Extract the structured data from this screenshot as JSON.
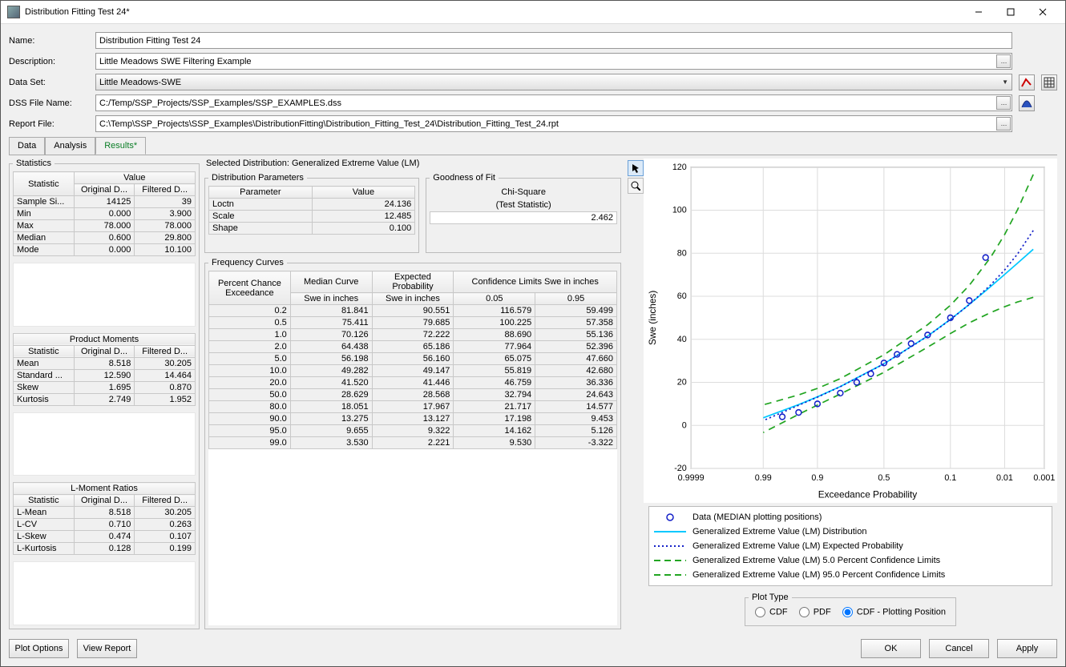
{
  "title": "Distribution Fitting Test 24*",
  "form": {
    "name_label": "Name:",
    "name_value": "Distribution Fitting Test 24",
    "desc_label": "Description:",
    "desc_value": "Little Meadows SWE Filtering Example",
    "dataset_label": "Data Set:",
    "dataset_value": "Little Meadows-SWE",
    "dssfile_label": "DSS File Name:",
    "dssfile_value": "C:/Temp/SSP_Projects/SSP_Examples/SSP_EXAMPLES.dss",
    "report_label": "Report File:",
    "report_value": "C:\\Temp\\SSP_Projects\\SSP_Examples\\DistributionFitting\\Distribution_Fitting_Test_24\\Distribution_Fitting_Test_24.rpt"
  },
  "tabs": {
    "data": "Data",
    "analysis": "Analysis",
    "results": "Results*"
  },
  "stats": {
    "fs_title": "Statistics",
    "hdr_stat": "Statistic",
    "hdr_value": "Value",
    "hdr_orig": "Original D...",
    "hdr_filt": "Filtered D...",
    "section1": [
      [
        "Sample Si...",
        "14125",
        "39"
      ],
      [
        "Min",
        "0.000",
        "3.900"
      ],
      [
        "Max",
        "78.000",
        "78.000"
      ],
      [
        "Median",
        "0.600",
        "29.800"
      ],
      [
        "Mode",
        "0.000",
        "10.100"
      ]
    ],
    "pm_title": "Product Moments",
    "pm": [
      [
        "Mean",
        "8.518",
        "30.205"
      ],
      [
        "Standard ...",
        "12.590",
        "14.464"
      ],
      [
        "Skew",
        "1.695",
        "0.870"
      ],
      [
        "Kurtosis",
        "2.749",
        "1.952"
      ]
    ],
    "lm_title": "L-Moment Ratios",
    "lm": [
      [
        "L-Mean",
        "8.518",
        "30.205"
      ],
      [
        "L-CV",
        "0.710",
        "0.263"
      ],
      [
        "L-Skew",
        "0.474",
        "0.107"
      ],
      [
        "L-Kurtosis",
        "0.128",
        "0.199"
      ]
    ]
  },
  "selected_dist_label": "Selected Distribution: Generalized Extreme Value (LM)",
  "params": {
    "title": "Distribution Parameters",
    "hdr_param": "Parameter",
    "hdr_value": "Value",
    "rows": [
      [
        "Loctn",
        "24.136"
      ],
      [
        "Scale",
        "12.485"
      ],
      [
        "Shape",
        "0.100"
      ]
    ]
  },
  "gof": {
    "title": "Goodness of Fit",
    "name": "Chi-Square",
    "sub": "(Test Statistic)",
    "value": "2.462"
  },
  "freq": {
    "title": "Frequency Curves",
    "hdr_pce": "Percent Chance Exceedance",
    "hdr_med": "Median Curve",
    "hdr_exp": "Expected Probability",
    "hdr_cl": "Confidence Limits Swe in inches",
    "hdr_swe": "Swe in inches",
    "hdr_005": "0.05",
    "hdr_095": "0.95",
    "rows": [
      [
        "0.2",
        "81.841",
        "90.551",
        "116.579",
        "59.499"
      ],
      [
        "0.5",
        "75.411",
        "79.685",
        "100.225",
        "57.358"
      ],
      [
        "1.0",
        "70.126",
        "72.222",
        "88.690",
        "55.136"
      ],
      [
        "2.0",
        "64.438",
        "65.186",
        "77.964",
        "52.396"
      ],
      [
        "5.0",
        "56.198",
        "56.160",
        "65.075",
        "47.660"
      ],
      [
        "10.0",
        "49.282",
        "49.147",
        "55.819",
        "42.680"
      ],
      [
        "20.0",
        "41.520",
        "41.446",
        "46.759",
        "36.336"
      ],
      [
        "50.0",
        "28.629",
        "28.568",
        "32.794",
        "24.643"
      ],
      [
        "80.0",
        "18.051",
        "17.967",
        "21.717",
        "14.577"
      ],
      [
        "90.0",
        "13.275",
        "13.127",
        "17.198",
        "9.453"
      ],
      [
        "95.0",
        "9.655",
        "9.322",
        "14.162",
        "5.126"
      ],
      [
        "99.0",
        "3.530",
        "2.221",
        "9.530",
        "-3.322"
      ]
    ]
  },
  "chart": {
    "ylabel": "Swe (inches)",
    "xlabel": "Exceedance Probability",
    "yticks": [
      "-20",
      "0",
      "20",
      "40",
      "60",
      "80",
      "100",
      "120"
    ],
    "xticks": [
      "0.9999",
      "0.99",
      "0.9",
      "0.5",
      "0.1",
      "0.01",
      "0.001"
    ]
  },
  "legend": {
    "l1": "Data (MEDIAN plotting positions)",
    "l2": "Generalized Extreme Value (LM) Distribution",
    "l3": "Generalized Extreme Value (LM) Expected Probability",
    "l4": "Generalized Extreme Value (LM) 5.0 Percent Confidence Limits",
    "l5": "Generalized Extreme Value (LM) 95.0 Percent Confidence Limits"
  },
  "plot_type": {
    "title": "Plot Type",
    "cdf": "CDF",
    "pdf": "PDF",
    "cdfpp": "CDF - Plotting Position"
  },
  "buttons": {
    "plot_options": "Plot Options",
    "view_report": "View Report",
    "ok": "OK",
    "cancel": "Cancel",
    "apply": "Apply"
  },
  "chart_data": {
    "type": "line",
    "xlabel": "Exceedance Probability",
    "ylabel": "Swe (inches)",
    "ylim": [
      -20,
      120
    ],
    "x_tick_labels": [
      "0.9999",
      "0.99",
      "0.9",
      "0.5",
      "0.1",
      "0.01",
      "0.001"
    ],
    "x_axis": "probability",
    "series": [
      {
        "name": "Distribution (Median Curve)",
        "x": [
          0.2,
          0.5,
          1.0,
          2.0,
          5.0,
          10.0,
          20.0,
          50.0,
          80.0,
          90.0,
          95.0,
          99.0
        ],
        "y": [
          81.841,
          75.411,
          70.126,
          64.438,
          56.198,
          49.282,
          41.52,
          28.629,
          18.051,
          13.275,
          9.655,
          3.53
        ],
        "style": "solid",
        "color": "#00c8ff"
      },
      {
        "name": "Expected Probability",
        "x": [
          0.2,
          0.5,
          1.0,
          2.0,
          5.0,
          10.0,
          20.0,
          50.0,
          80.0,
          90.0,
          95.0,
          99.0
        ],
        "y": [
          90.551,
          79.685,
          72.222,
          65.186,
          56.16,
          49.147,
          41.446,
          28.568,
          17.967,
          13.127,
          9.322,
          2.221
        ],
        "style": "dotted",
        "color": "#1420c8"
      },
      {
        "name": "5% Confidence Limit",
        "x": [
          0.2,
          0.5,
          1.0,
          2.0,
          5.0,
          10.0,
          20.0,
          50.0,
          80.0,
          90.0,
          95.0,
          99.0
        ],
        "y": [
          116.579,
          100.225,
          88.69,
          77.964,
          65.075,
          55.819,
          46.759,
          32.794,
          21.717,
          17.198,
          14.162,
          9.53
        ],
        "style": "dashed",
        "color": "#22a522"
      },
      {
        "name": "95% Confidence Limit",
        "x": [
          0.2,
          0.5,
          1.0,
          2.0,
          5.0,
          10.0,
          20.0,
          50.0,
          80.0,
          90.0,
          95.0,
          99.0
        ],
        "y": [
          59.499,
          57.358,
          55.136,
          52.396,
          47.66,
          42.68,
          36.336,
          24.643,
          14.577,
          9.453,
          5.126,
          -3.322
        ],
        "style": "dashed",
        "color": "#22a522"
      }
    ],
    "scatter": {
      "name": "Data (MEDIAN plotting positions)",
      "approx_points": 39,
      "sample_x": [
        97.5,
        95,
        90,
        80,
        70,
        60,
        50,
        40,
        30,
        20,
        10,
        5,
        2.5
      ],
      "sample_y": [
        4,
        6,
        10,
        15,
        20,
        24,
        29,
        33,
        38,
        42,
        50,
        58,
        78
      ],
      "marker": "o",
      "color": "#1420c8"
    }
  }
}
